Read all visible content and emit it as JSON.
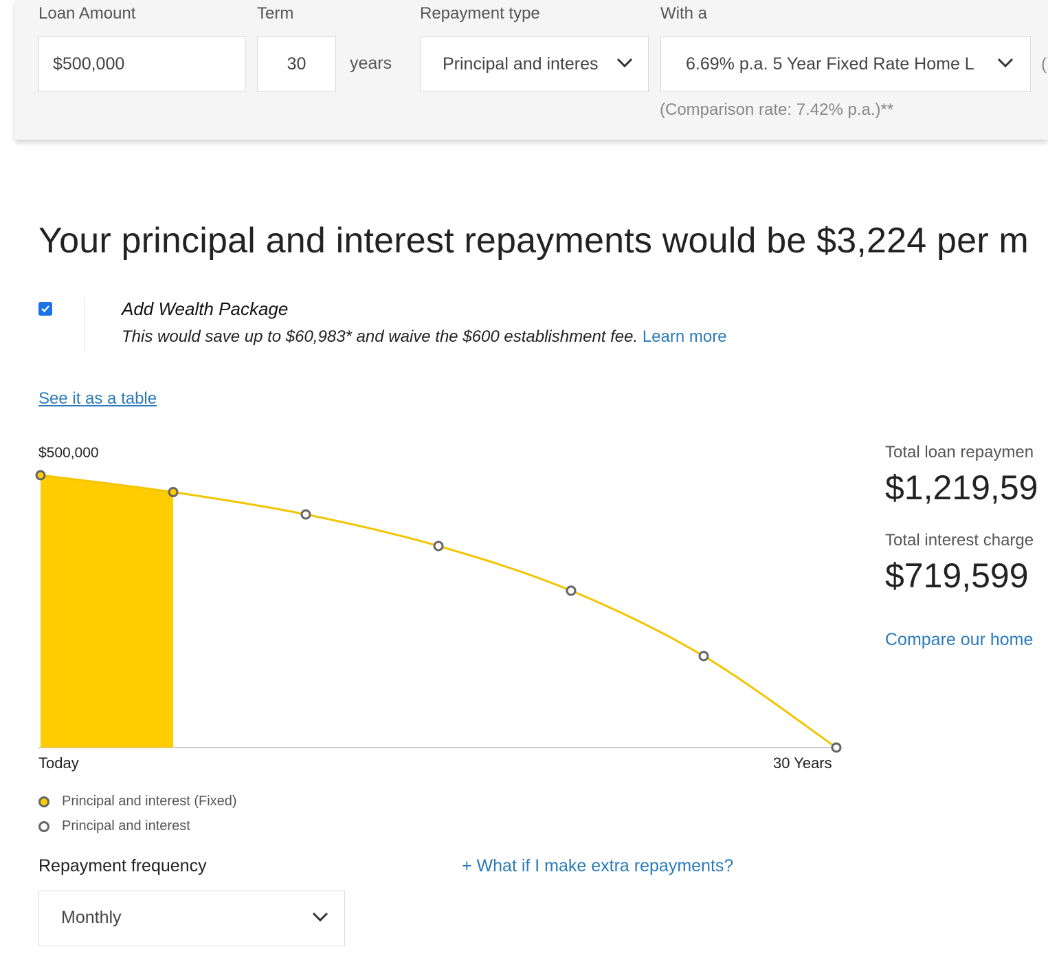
{
  "form": {
    "loan_amount_label": "Loan Amount",
    "loan_amount_value": "$500,000",
    "term_label": "Term",
    "term_value": "30",
    "term_unit": "years",
    "repayment_type_label": "Repayment type",
    "repayment_type_value": "Principal and interes",
    "rate_label": "With a",
    "rate_value": "6.69% p.a. 5 Year Fixed Rate Home L",
    "cutoff_char": "(",
    "comparison_text": "(Comparison rate: 7.42% p.a.)**"
  },
  "headline": "Your principal and interest repayments would be $3,224 per m",
  "wealth": {
    "checked": true,
    "title": "Add Wealth Package",
    "description": "This would save up to $60,983* and waive the $600 establishment fee.",
    "learn_more": "Learn more"
  },
  "table_link": "See it as a table",
  "chart_data": {
    "type": "area",
    "y_top_label": "$500,000",
    "x_start_label": "Today",
    "x_end_label": "30 Years",
    "ylim": [
      0,
      500000
    ],
    "xlim": [
      0,
      30
    ],
    "series": [
      {
        "name": "Principal and interest (Fixed)",
        "color": "#ffcc00",
        "x": [
          0,
          5
        ],
        "y": [
          500000,
          469000
        ]
      },
      {
        "name": "Principal and interest",
        "color": "#f2c500",
        "x": [
          5,
          10,
          15,
          20,
          25,
          30
        ],
        "y": [
          469000,
          428000,
          370000,
          288000,
          168000,
          0
        ]
      }
    ]
  },
  "legend": [
    {
      "label": "Principal and interest (Fixed)",
      "fill": "#ffcc00"
    },
    {
      "label": "Principal and interest",
      "fill": "#ffffff"
    }
  ],
  "summary": {
    "total_repay_label": "Total loan repaymen",
    "total_repay_value": "$1,219,59",
    "total_interest_label": "Total interest charge",
    "total_interest_value": "$719,599",
    "compare_link": "Compare our home"
  },
  "frequency": {
    "label": "Repayment frequency",
    "value": "Monthly",
    "extra_link": "+ What if I make extra repayments?"
  },
  "colors": {
    "accent": "#ffcc00",
    "link": "#2b7bb9",
    "checkbox": "#1a73e8"
  }
}
